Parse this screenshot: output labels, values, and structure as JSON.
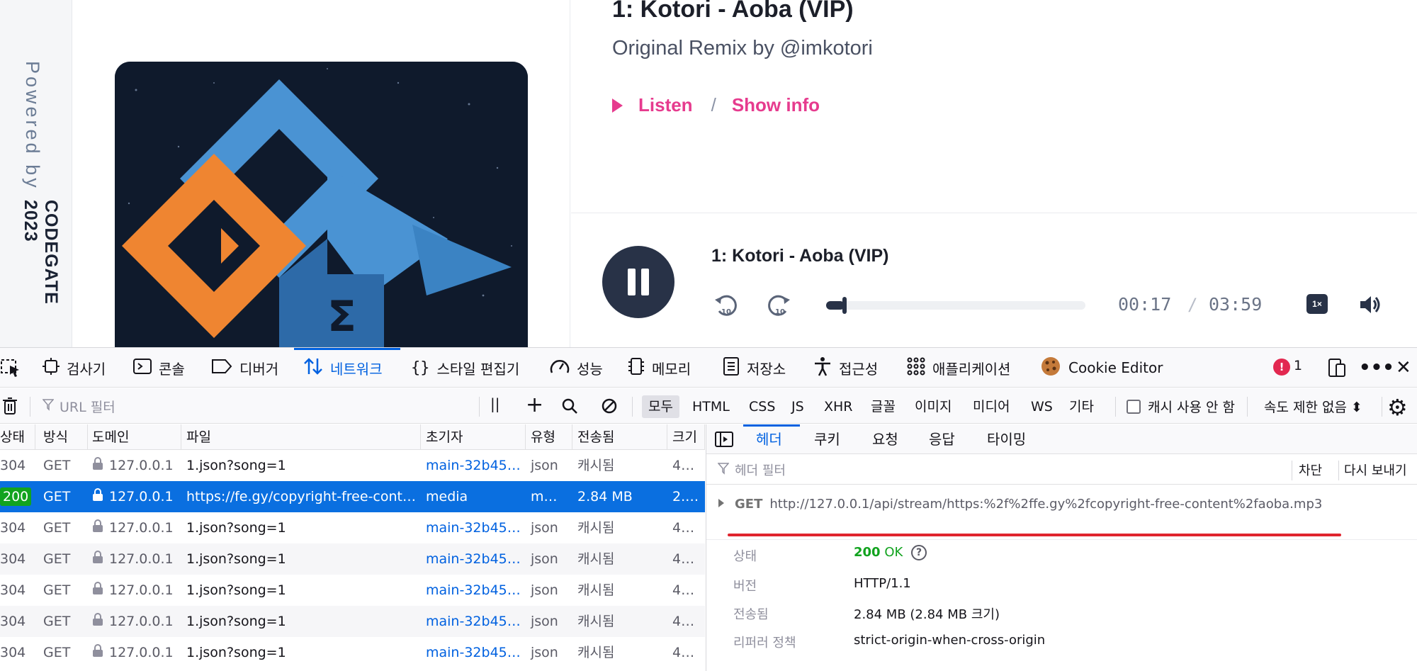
{
  "page": {
    "powered_by": "Powered by",
    "brand": "CODEGATE 2023",
    "song": {
      "title": "1: Kotori - Aoba (VIP)",
      "subtitle": "Original Remix by @imkotori",
      "listen_label": "Listen",
      "separator": "/",
      "show_info_label": "Show info"
    },
    "player": {
      "title": "1: Kotori - Aoba (VIP)",
      "current_time": "00:17",
      "time_separator": "/",
      "total_time": "03:59",
      "progress_fraction": 0.071,
      "speed_label": "1×"
    },
    "colors": {
      "accent_pink": "#e63b8e",
      "player_dark": "#283247",
      "cover_orange": "#ef8531",
      "cover_blue": "#4a93d3",
      "devtools_blue": "#0061e0",
      "status_green": "#12a31f"
    }
  },
  "devtools": {
    "tabs": [
      {
        "label": "검사기",
        "icon": "inspector-icon"
      },
      {
        "label": "콘솔",
        "icon": "console-icon"
      },
      {
        "label": "디버거",
        "icon": "debugger-icon"
      },
      {
        "label": "네트워크",
        "icon": "network-icon"
      },
      {
        "label": "스타일 편집기",
        "icon": "style-editor-icon"
      },
      {
        "label": "성능",
        "icon": "performance-icon"
      },
      {
        "label": "메모리",
        "icon": "memory-icon"
      },
      {
        "label": "저장소",
        "icon": "storage-icon"
      },
      {
        "label": "접근성",
        "icon": "accessibility-icon"
      },
      {
        "label": "애플리케이션",
        "icon": "application-icon"
      },
      {
        "label": "Cookie Editor",
        "icon": "cookie-icon"
      }
    ],
    "error_count": "1",
    "toolbar": {
      "url_filter_placeholder": "URL 필터",
      "filters": [
        "모두",
        "HTML",
        "CSS",
        "JS",
        "XHR",
        "글꼴",
        "이미지",
        "미디어",
        "WS",
        "기타"
      ],
      "active_filter": "모두",
      "disable_cache_label": "캐시 사용 안 함",
      "throttle_label": "속도 제한 없음 ⬍"
    },
    "table": {
      "columns": [
        "상태",
        "방식",
        "도메인",
        "파일",
        "초기자",
        "유형",
        "전송됨",
        "크기"
      ],
      "rows": [
        {
          "status": "304",
          "method": "GET",
          "domain": "127.0.0.1",
          "file": "1.json?song=1",
          "initiator": "main-32b45…",
          "type": "json",
          "transferred": "캐시됨",
          "size": "4…"
        },
        {
          "status": "200",
          "method": "GET",
          "domain": "127.0.0.1",
          "file": "https://fe.gy/copyright-free-content",
          "initiator": "media",
          "type": "m…",
          "transferred": "2.84 MB",
          "size": "2.…",
          "selected": true
        },
        {
          "status": "304",
          "method": "GET",
          "domain": "127.0.0.1",
          "file": "1.json?song=1",
          "initiator": "main-32b45…",
          "type": "json",
          "transferred": "캐시됨",
          "size": "4…"
        },
        {
          "status": "304",
          "method": "GET",
          "domain": "127.0.0.1",
          "file": "1.json?song=1",
          "initiator": "main-32b45…",
          "type": "json",
          "transferred": "캐시됨",
          "size": "4…"
        },
        {
          "status": "304",
          "method": "GET",
          "domain": "127.0.0.1",
          "file": "1.json?song=1",
          "initiator": "main-32b45…",
          "type": "json",
          "transferred": "캐시됨",
          "size": "4…"
        },
        {
          "status": "304",
          "method": "GET",
          "domain": "127.0.0.1",
          "file": "1.json?song=1",
          "initiator": "main-32b45…",
          "type": "json",
          "transferred": "캐시됨",
          "size": "4…"
        },
        {
          "status": "304",
          "method": "GET",
          "domain": "127.0.0.1",
          "file": "1.json?song=1",
          "initiator": "main-32b45…",
          "type": "json",
          "transferred": "캐시됨",
          "size": "4…"
        }
      ]
    },
    "details": {
      "tabs": [
        "헤더",
        "쿠키",
        "요청",
        "응답",
        "타이밍"
      ],
      "selected_tab": "헤더",
      "header_filter_placeholder": "헤더 필터",
      "block_label": "차단",
      "resend_label": "다시 보내기",
      "request_method": "GET",
      "request_url": "http://127.0.0.1/api/stream/https:%2f%2ffe.gy%2fcopyright-free-content%2faoba.mp3",
      "status_key": "상태",
      "status_code": "200",
      "status_text": "OK",
      "version_key": "버전",
      "version_value": "HTTP/1.1",
      "transferred_key": "전송됨",
      "transferred_value": "2.84 MB (2.84 MB 크기)",
      "referrer_key": "리퍼러 정책",
      "referrer_value": "strict-origin-when-cross-origin"
    }
  }
}
